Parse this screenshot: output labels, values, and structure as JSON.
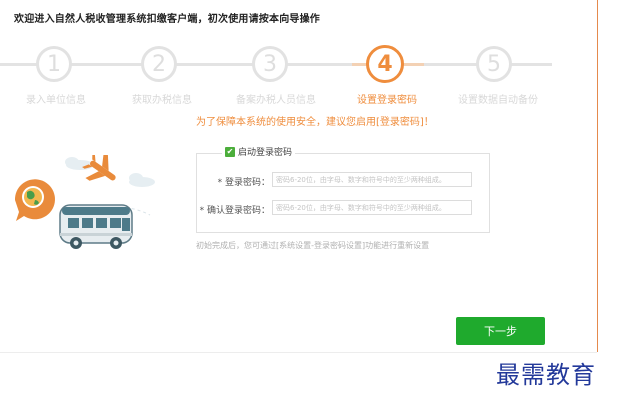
{
  "header": {
    "welcome_text": "欢迎进入自然人税收管理系统扣缴客户端，初次使用请按本向导操作"
  },
  "wizard": {
    "current_step": 4,
    "steps": [
      {
        "number": "1",
        "label": "录入单位信息"
      },
      {
        "number": "2",
        "label": "获取办税信息"
      },
      {
        "number": "3",
        "label": "备案办税人员信息"
      },
      {
        "number": "4",
        "label": "设置登录密码"
      },
      {
        "number": "5",
        "label": "设置数据自动备份"
      }
    ]
  },
  "form": {
    "warning": "为了保障本系统的使用安全，建议您启用[登录密码]！",
    "enable_label": "启动登录密码",
    "enable_checked": true,
    "password_label": "* 登录密码：",
    "password_placeholder": "密码6-20位，由字母、数字和符号中的至少两种组成。",
    "confirm_label": "* 确认登录密码：",
    "confirm_placeholder": "密码6-20位，由字母、数字和符号中的至少两种组成。",
    "hint": "初始完成后，您可通过[系统设置-登录密码设置]功能进行重新设置"
  },
  "actions": {
    "next_label": "下一步"
  },
  "watermark": {
    "text": "最需教育"
  },
  "colors": {
    "accent_orange": "#ef8d3d",
    "button_green": "#1faa2d",
    "inactive_gray": "#e2e2e2",
    "watermark_blue": "#23399a"
  }
}
